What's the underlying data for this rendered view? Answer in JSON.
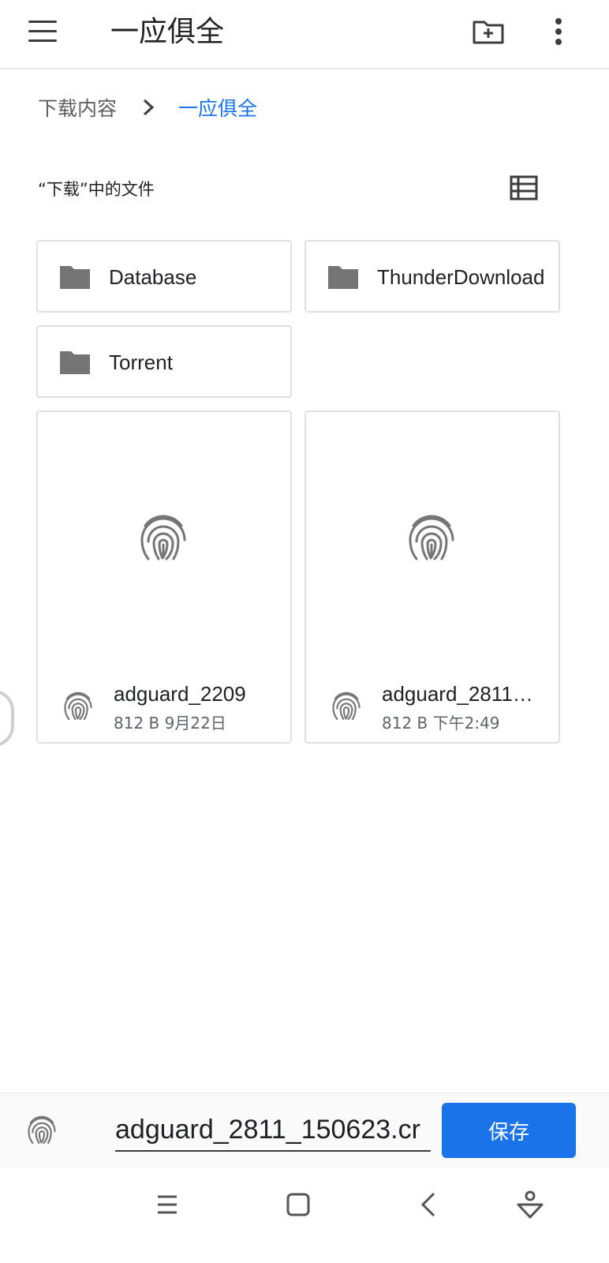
{
  "app_bar": {
    "title": "一应俱全",
    "icons": [
      "menu-icon",
      "new-folder-icon",
      "more-vert-icon"
    ]
  },
  "breadcrumb": {
    "items": [
      "下载内容",
      "一应俱全"
    ]
  },
  "section": {
    "title": "“下载”中的文件"
  },
  "folders": [
    {
      "name": "Database"
    },
    {
      "name": "ThunderDownload"
    },
    {
      "name": "Torrent"
    }
  ],
  "files": [
    {
      "name": "adguard_2209",
      "size": "812 B",
      "date": "9月22日"
    },
    {
      "name": "adguard_2811_150623",
      "size": "812 B",
      "date": "下午2:49"
    }
  ],
  "save_bar": {
    "filename": "adguard_2811_150623.cr",
    "save_label": "保存"
  },
  "colors": {
    "accent": "#1a73e8",
    "icon_gray": "#757575"
  }
}
